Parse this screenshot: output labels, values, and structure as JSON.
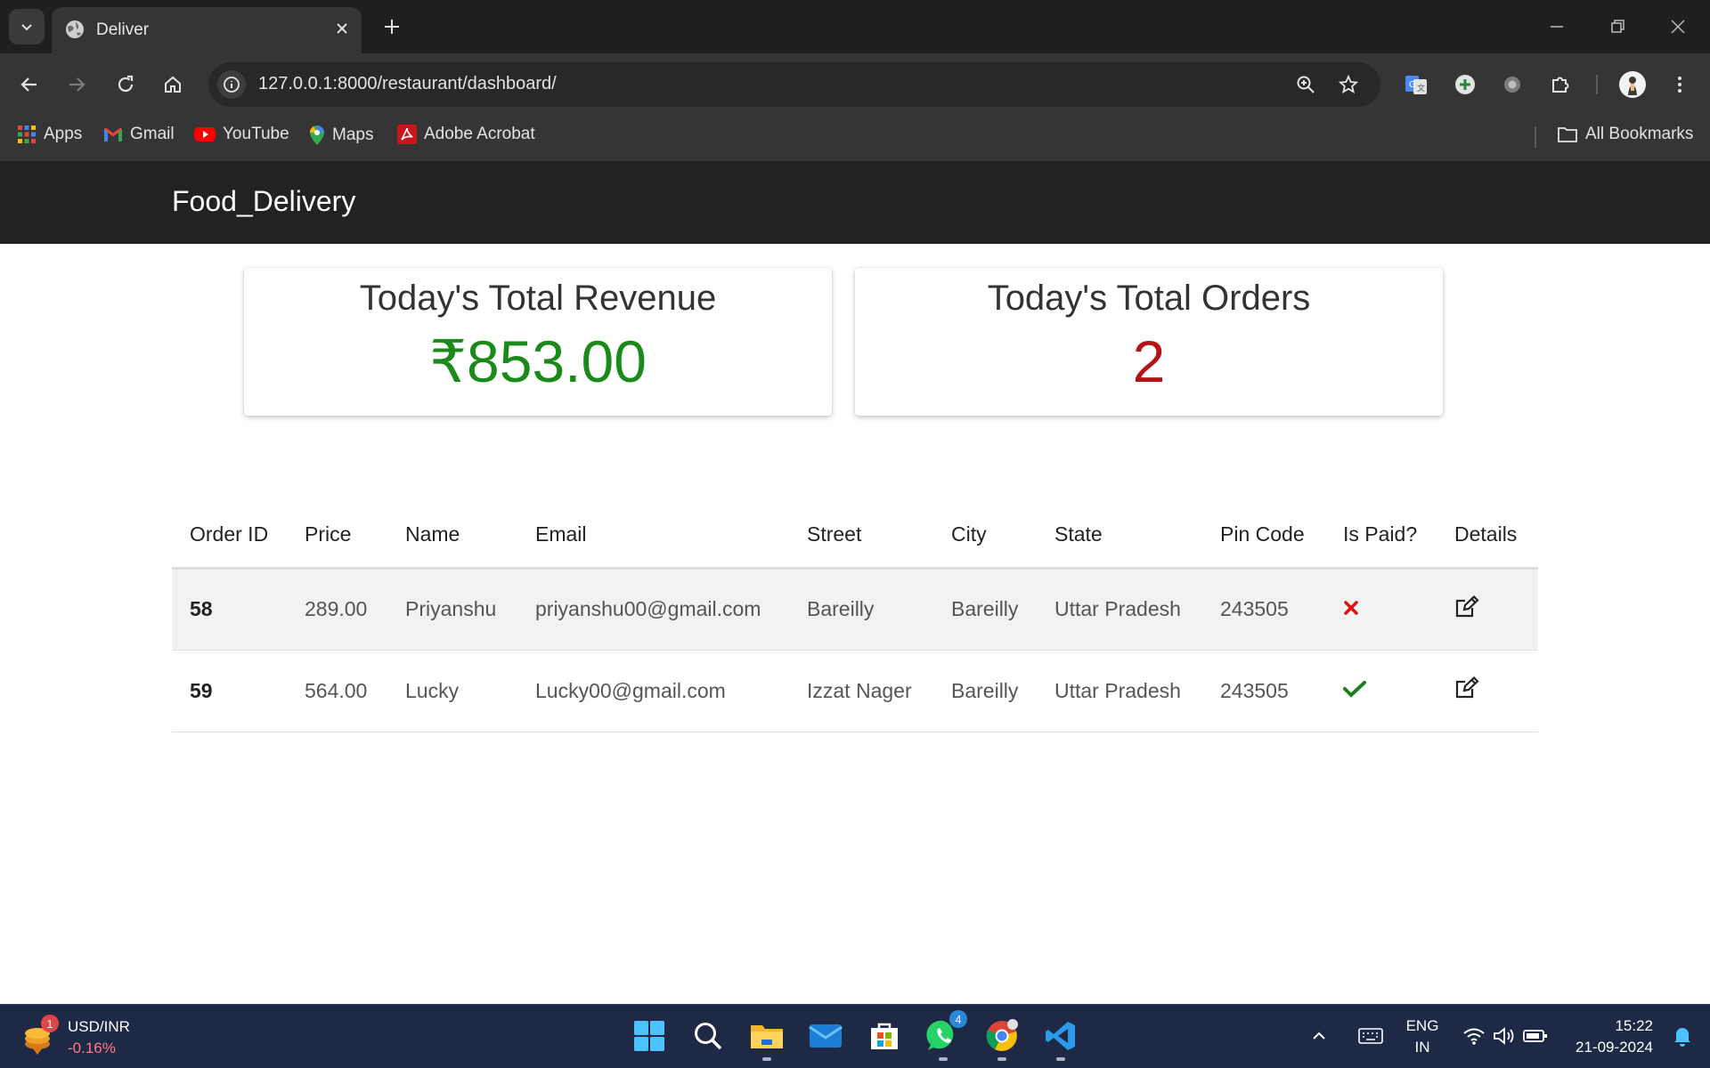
{
  "browser": {
    "tab_title": "Deliver",
    "url": "127.0.0.1:8000/restaurant/dashboard/",
    "bookmarks": [
      "Apps",
      "Gmail",
      "YouTube",
      "Maps",
      "Adobe Acrobat"
    ],
    "all_bookmarks": "All Bookmarks"
  },
  "navbar": {
    "brand": "Food_Delivery"
  },
  "stats": {
    "revenue_title": "Today's Total Revenue",
    "revenue_value": "₹853.00",
    "orders_title": "Today's Total Orders",
    "orders_value": "2",
    "revenue_color": "#1a8a1a",
    "orders_color": "#b31414"
  },
  "table": {
    "headers": [
      "Order ID",
      "Price",
      "Name",
      "Email",
      "Street",
      "City",
      "State",
      "Pin Code",
      "Is Paid?",
      "Details"
    ],
    "rows": [
      {
        "order_id": "58",
        "price": "289.00",
        "name": "Priyanshu",
        "email": "priyanshu00@gmail.com",
        "street": "Bareilly",
        "city": "Bareilly",
        "state": "Uttar Pradesh",
        "pin": "243505",
        "is_paid_icon": "cross-icon",
        "details_icon": "edit-icon"
      },
      {
        "order_id": "59",
        "price": "564.00",
        "name": "Lucky",
        "email": "Lucky00@gmail.com",
        "street": "Izzat Nager",
        "city": "Bareilly",
        "state": "Uttar Pradesh",
        "pin": "243505",
        "is_paid_icon": "check-icon",
        "details_icon": "edit-icon"
      }
    ]
  },
  "taskbar": {
    "widget_title": "USD/INR",
    "widget_change": "-0.16%",
    "widget_badge": "1",
    "whatsapp_badge": "4",
    "lang_top": "ENG",
    "lang_bottom": "IN",
    "time": "15:22",
    "date": "21-09-2024"
  }
}
